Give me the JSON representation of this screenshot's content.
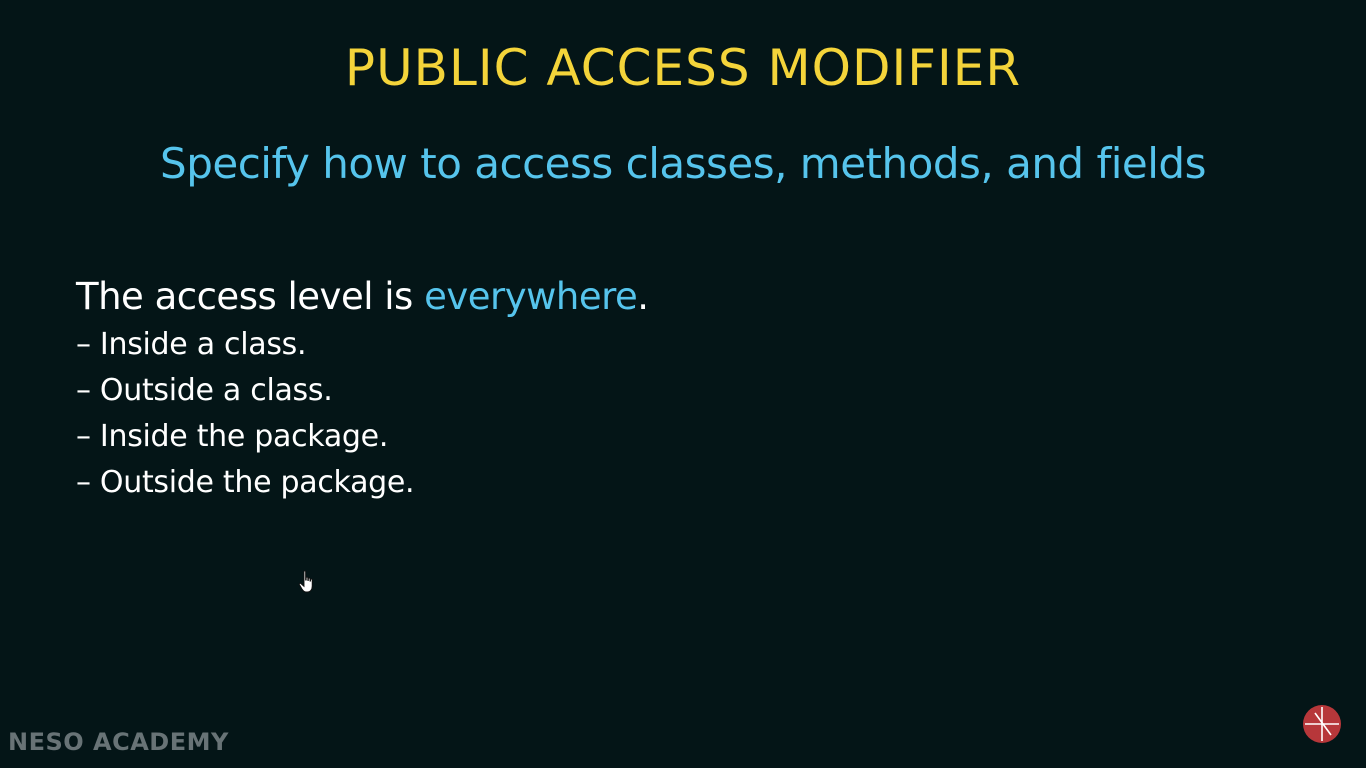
{
  "slide": {
    "title": "PUBLIC ACCESS MODIFIER",
    "subtitle": "Specify how to access classes, methods, and fields",
    "lead_text": "The access level is ",
    "lead_highlight": "everywhere",
    "lead_end": ".",
    "bullets": [
      "– Inside a class.",
      "– Outside a class.",
      "– Inside the package.",
      "– Outside the package."
    ]
  },
  "branding": {
    "watermark": "NESO ACADEMY",
    "corner_logo_icon": "neso-logo-icon"
  },
  "colors": {
    "background": "#041517",
    "title": "#f4d43a",
    "accent": "#56c4ec",
    "text": "#ffffff"
  }
}
